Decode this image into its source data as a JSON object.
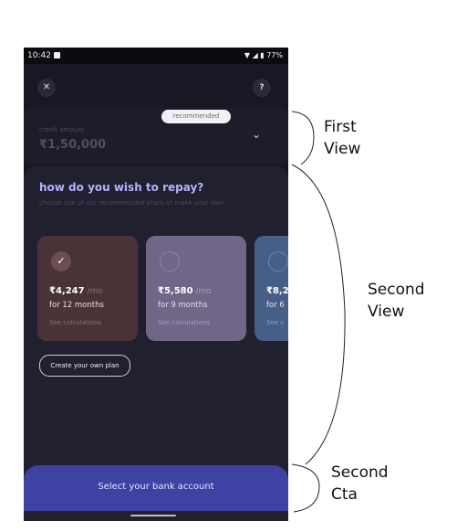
{
  "status_bar": {
    "time": "10:42",
    "battery": "77%"
  },
  "header": {
    "close_icon": "close-icon",
    "help_label": "?"
  },
  "credit": {
    "label": "credit amount",
    "amount": "₹1,50,000"
  },
  "repay": {
    "title": "how do you wish to repay?",
    "subtitle": "choose one of our recommended plans or make your own",
    "badge": "recommended",
    "plans": [
      {
        "amount": "₹4,247",
        "per": " /mo",
        "tenure": "for 12 months",
        "calc": "See calculations",
        "selected": true
      },
      {
        "amount": "₹5,580",
        "per": " /mo",
        "tenure": "for 9 months",
        "calc": "See calculations",
        "selected": false
      },
      {
        "amount": "₹8,2",
        "per": "",
        "tenure": "for 6",
        "calc": "See c",
        "selected": false
      }
    ],
    "own_plan_label": "Create your own plan"
  },
  "cta": {
    "label": "Select your bank account"
  },
  "annotations": {
    "first": [
      "First",
      "View"
    ],
    "second": [
      "Second",
      "View"
    ],
    "cta": [
      "Second",
      "Cta"
    ]
  },
  "colors": {
    "background": "#181824",
    "accent": "#3f41a3",
    "title": "#b7b1ff"
  }
}
